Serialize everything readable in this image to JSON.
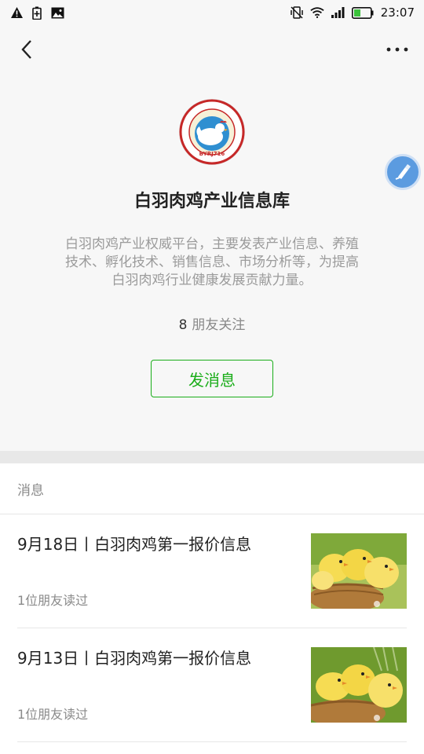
{
  "status_bar": {
    "time": "23:07",
    "left_icons": [
      "warning-icon",
      "battery-saver-icon",
      "image-icon"
    ],
    "right_icons": [
      "vibrate-icon",
      "wifi-icon",
      "signal-icon",
      "battery-icon"
    ],
    "battery_level": 0.4
  },
  "header": {
    "back_icon": "back-chevron-icon",
    "more_icon": "more-dots-icon"
  },
  "profile": {
    "logo_text": "BYRJ716",
    "name": "白羽肉鸡产业信息库",
    "description": "白羽肉鸡产业权威平台，主要发表产业信息、养殖技术、孵化技术、销售信息、市场分析等，为提高白羽肉鸡行业健康发展贡献力量。",
    "followers_count": "8",
    "followers_label": "朋友关注",
    "send_message_label": "发消息"
  },
  "messages": {
    "section_label": "消息",
    "items": [
      {
        "title": "9月18日丨白羽肉鸡第一报价信息",
        "reads": "1位朋友读过"
      },
      {
        "title": "9月13日丨白羽肉鸡第一报价信息",
        "reads": "1位朋友读过"
      }
    ]
  },
  "colors": {
    "accent": "#1aad19",
    "brush_button": "#5b9be0",
    "logo_ring": "#c62828"
  }
}
